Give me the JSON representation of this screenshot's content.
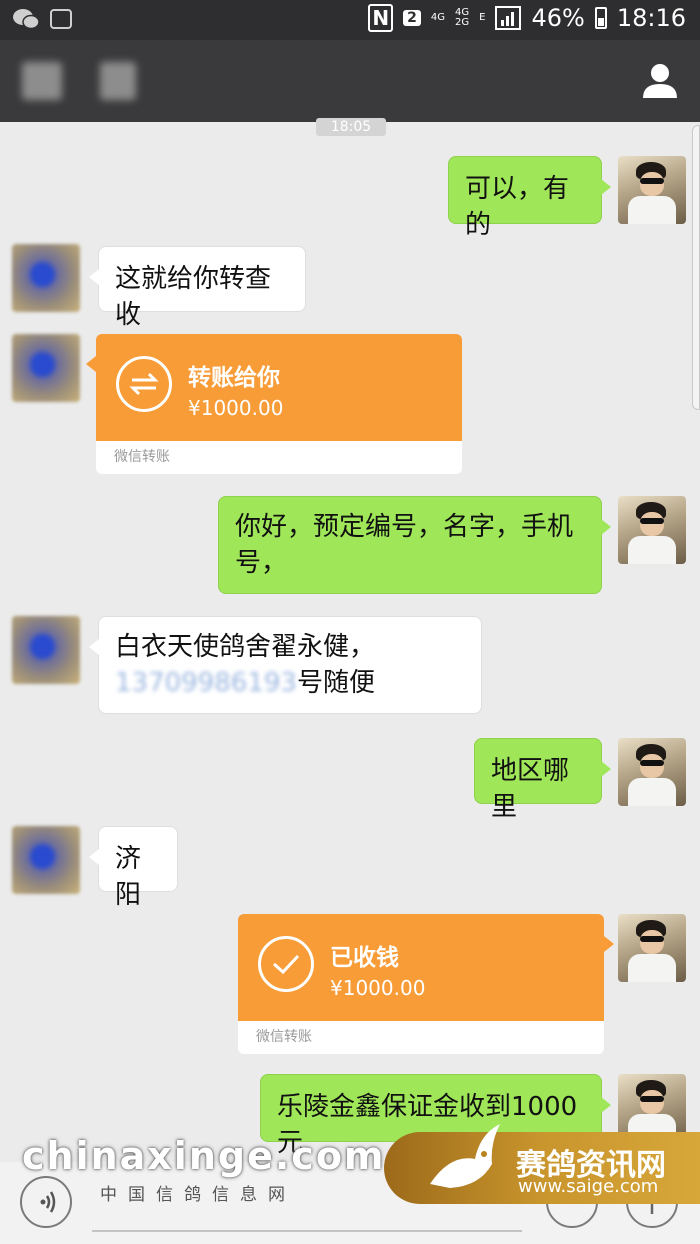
{
  "status_bar": {
    "carrier_2": "2",
    "net_1": "4G",
    "net_2": "4G",
    "net_2b": "2G",
    "net_e": "E",
    "battery": "46%",
    "time": "18:16"
  },
  "chat": {
    "timestamp": "18:05",
    "messages": [
      {
        "from": "me",
        "text": "可以，有的"
      },
      {
        "from": "other",
        "text": "这就给你转查收"
      },
      {
        "from": "other",
        "type": "transfer",
        "title": "转账给你",
        "amount": "¥1000.00",
        "footer": "微信转账"
      },
      {
        "from": "me",
        "text": "你好，预定编号，名字，手机号，",
        "line1": "你好，预定编号，名字，手机",
        "line2": "号，"
      },
      {
        "from": "other",
        "line1": "白衣天使鸽舍翟永健，",
        "line2_blurred": "13709986193",
        "line2_tail": "号随便"
      },
      {
        "from": "me",
        "text": "地区哪里"
      },
      {
        "from": "other",
        "text": "济阳"
      },
      {
        "from": "me",
        "type": "transfer",
        "title": "已收钱",
        "amount": "¥1000.00",
        "footer": "微信转账"
      },
      {
        "from": "me",
        "text": "乐陵金鑫保证金收到1000元"
      }
    ]
  },
  "watermarks": {
    "left_big": "chinaxinge.com",
    "left_small": "中国信鸽信息网",
    "right_name": "赛鸽资讯网",
    "right_url": "www.saige.com"
  },
  "colors": {
    "my_bubble": "#9fe658",
    "transfer": "#f89c37",
    "header": "#3a3a3c"
  }
}
